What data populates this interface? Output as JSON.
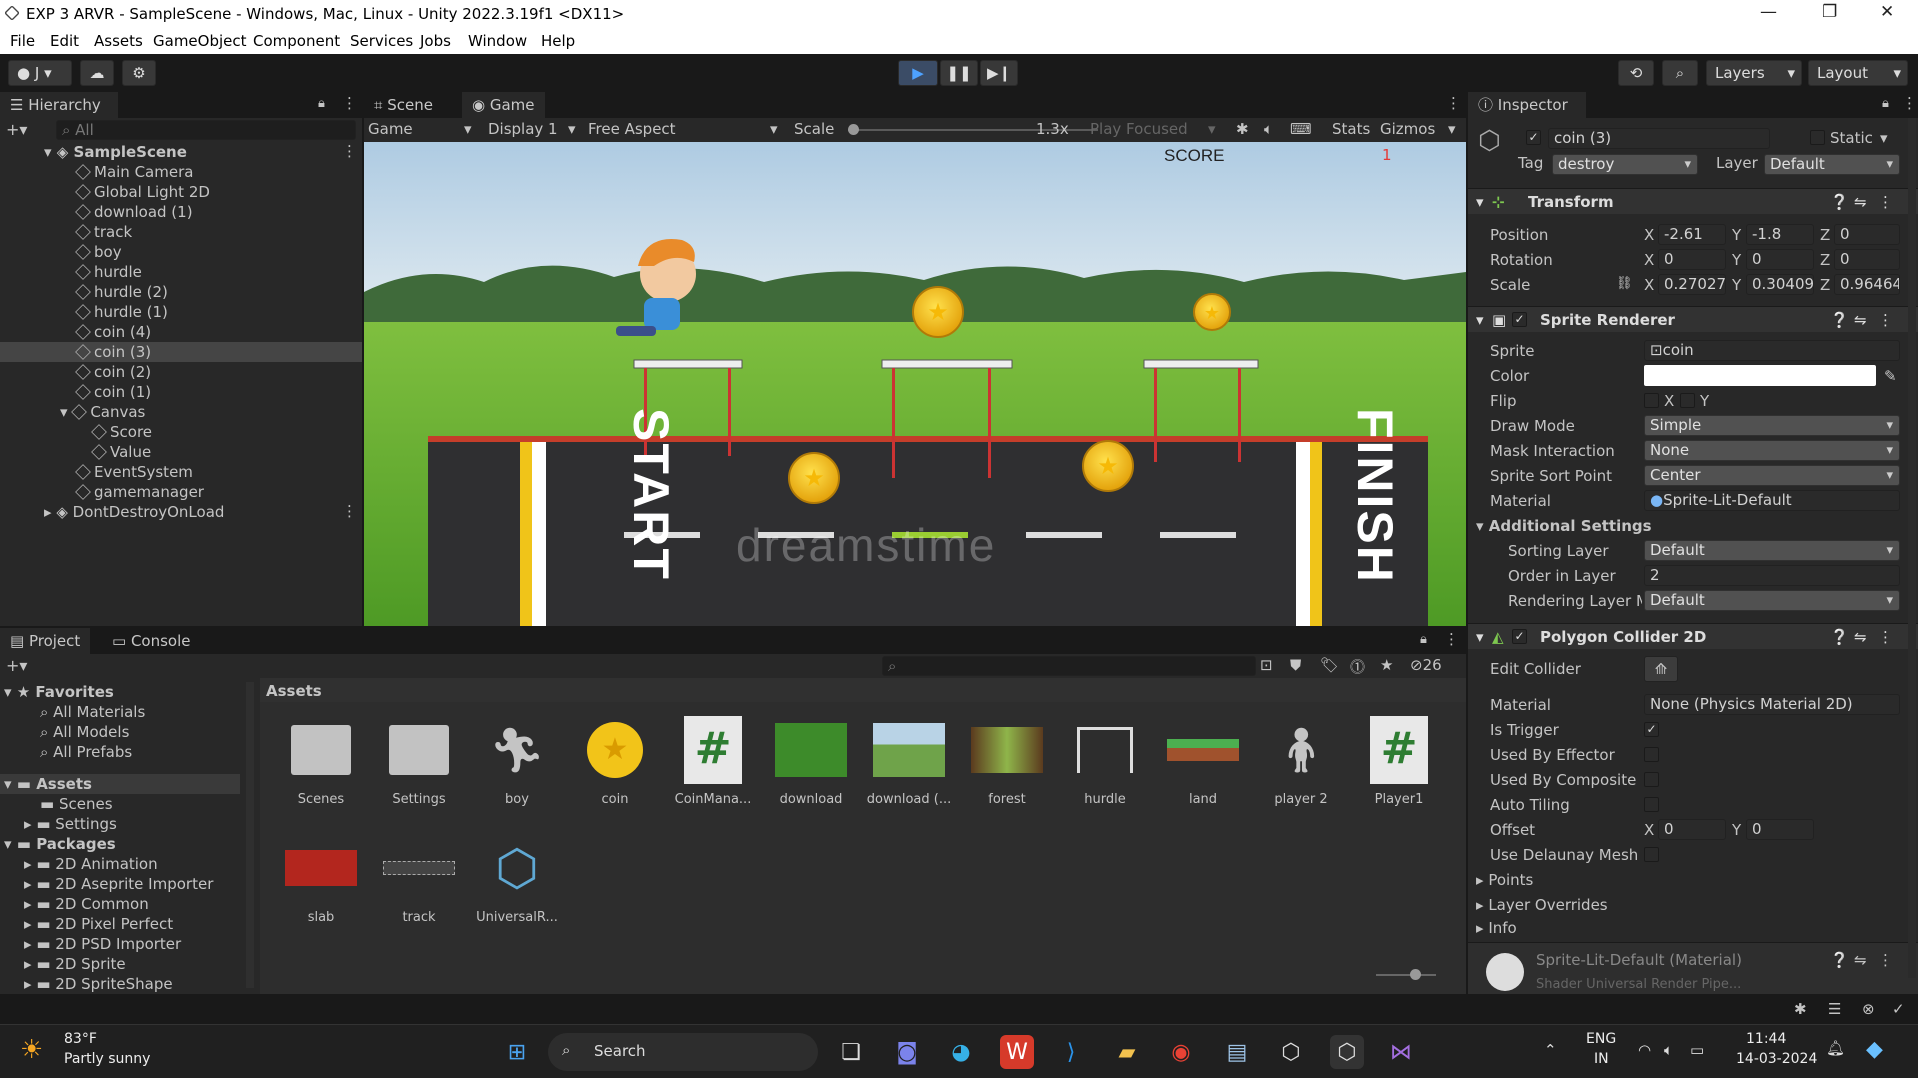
{
  "window": {
    "title": "EXP 3 ARVR - SampleScene - Windows, Mac, Linux - Unity 2022.3.19f1 <DX11>"
  },
  "menu": [
    "File",
    "Edit",
    "Assets",
    "GameObject",
    "Component",
    "Services",
    "Jobs",
    "Window",
    "Help"
  ],
  "toolbar": {
    "account": "J",
    "layers": "Layers",
    "layout": "Layout"
  },
  "hierarchy": {
    "tab": "Hierarchy",
    "search_placeholder": "All",
    "scene": "SampleScene",
    "items": [
      "Main Camera",
      "Global Light 2D",
      "download (1)",
      "track",
      "boy",
      "hurdle",
      "hurdle (2)",
      "hurdle (1)",
      "coin (4)",
      "coin (3)",
      "coin (2)",
      "coin (1)",
      "Canvas",
      "Score",
      "Value",
      "EventSystem",
      "gamemanager"
    ],
    "dontdestroy": "DontDestroyOnLoad"
  },
  "game": {
    "tabs": [
      "Scene",
      "Game"
    ],
    "mode": "Game",
    "display": "Display 1",
    "aspect": "Free Aspect",
    "scale_label": "Scale",
    "scale_value": "1.3x",
    "play_focused": "Play Focused",
    "stats": "Stats",
    "gizmos": "Gizmos",
    "score_label": "SCORE",
    "score_value": "1",
    "start_text": "START",
    "finish_text": "FINISH",
    "watermark": "dreamstime"
  },
  "inspector": {
    "tab": "Inspector",
    "object_name": "coin (3)",
    "static_label": "Static",
    "tag_label": "Tag",
    "tag": "destroy",
    "layer_label": "Layer",
    "layer": "Default",
    "transform": {
      "title": "Transform",
      "position_label": "Position",
      "pos": [
        "-2.61",
        "-1.8",
        "0"
      ],
      "rotation_label": "Rotation",
      "rot": [
        "0",
        "0",
        "0"
      ],
      "scale_label": "Scale",
      "scl": [
        "0.27027",
        "0.30409",
        "0.96464"
      ]
    },
    "sprite_renderer": {
      "title": "Sprite Renderer",
      "labels": [
        "Sprite",
        "Color",
        "Flip",
        "Draw Mode",
        "Mask Interaction",
        "Sprite Sort Point",
        "Material"
      ],
      "sprite": "coin",
      "flip_x": "X",
      "flip_y": "Y",
      "draw_mode": "Simple",
      "mask": "None",
      "sort_point": "Center",
      "material": "Sprite-Lit-Default",
      "additional": "Additional Settings",
      "sorting_layer_label": "Sorting Layer",
      "sorting_layer": "Default",
      "order_label": "Order in Layer",
      "order": "2",
      "rendering_label": "Rendering Layer M",
      "rendering": "Default"
    },
    "polygon": {
      "title": "Polygon Collider 2D",
      "labels": [
        "Edit Collider",
        "Material",
        "Is Trigger",
        "Used By Effector",
        "Used By Composite",
        "Auto Tiling",
        "Offset",
        "Use Delaunay Mesh"
      ],
      "material": "None (Physics Material 2D)",
      "offset": [
        "0",
        "0"
      ],
      "foldouts": [
        "Points",
        "Layer Overrides",
        "Info"
      ]
    },
    "material_footer": "Sprite-Lit-Default (Material)",
    "shader_footer": "Shader   Universal Render Pipe..."
  },
  "project": {
    "tabs": [
      "Project",
      "Console"
    ],
    "favorites": "Favorites",
    "fav_items": [
      "All Materials",
      "All Models",
      "All Prefabs"
    ],
    "assets": "Assets",
    "asset_folders": [
      "Scenes",
      "Settings"
    ],
    "packages": "Packages",
    "package_items": [
      "2D Animation",
      "2D Aseprite Importer",
      "2D Common",
      "2D Pixel Perfect",
      "2D PSD Importer",
      "2D Sprite",
      "2D SpriteShape"
    ],
    "hidden_count": "26",
    "grid_title": "Assets",
    "grid": [
      "Scenes",
      "Settings",
      "boy",
      "coin",
      "CoinMana...",
      "download",
      "download (...",
      "forest",
      "hurdle",
      "land",
      "player 2",
      "Player1",
      "slab",
      "track",
      "UniversalR..."
    ]
  },
  "taskbar": {
    "weather_temp": "83°F",
    "weather_desc": "Partly sunny",
    "search": "Search",
    "lang1": "ENG",
    "lang2": "IN",
    "time": "11:44",
    "date": "14-03-2024"
  }
}
